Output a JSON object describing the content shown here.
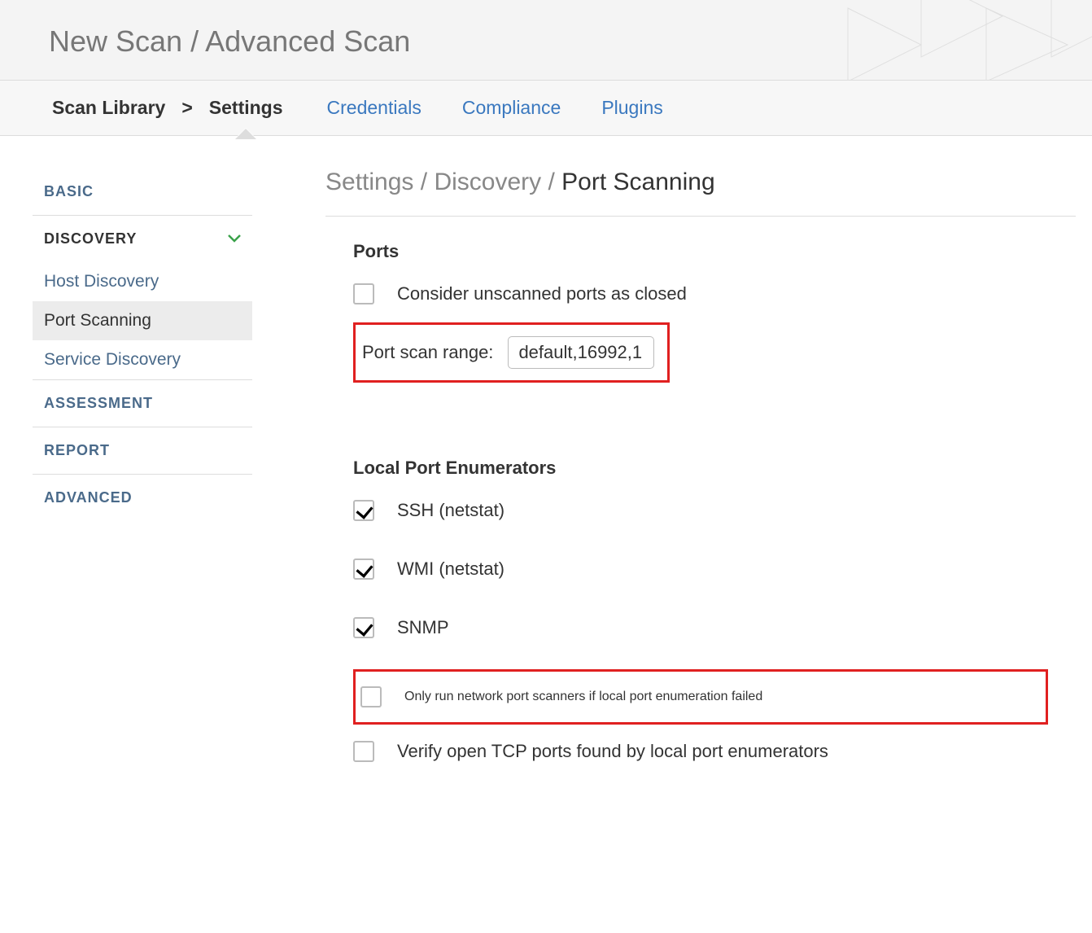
{
  "header": {
    "title": "New Scan / Advanced Scan"
  },
  "tabs": {
    "breadcrumb_root": "Scan Library",
    "breadcrumb_sep": ">",
    "breadcrumb_current": "Settings",
    "items": [
      {
        "label": "Credentials"
      },
      {
        "label": "Compliance"
      },
      {
        "label": "Plugins"
      }
    ]
  },
  "sidebar": {
    "sections": [
      {
        "label": "BASIC",
        "expanded": false
      },
      {
        "label": "DISCOVERY",
        "expanded": true,
        "children": [
          {
            "label": "Host Discovery",
            "selected": false
          },
          {
            "label": "Port Scanning",
            "selected": true
          },
          {
            "label": "Service Discovery",
            "selected": false
          }
        ]
      },
      {
        "label": "ASSESSMENT",
        "expanded": false
      },
      {
        "label": "REPORT",
        "expanded": false
      },
      {
        "label": "ADVANCED",
        "expanded": false
      }
    ]
  },
  "content": {
    "breadcrumb": {
      "a": "Settings",
      "b": "Discovery",
      "c": "Port Scanning",
      "sep": "/"
    },
    "ports": {
      "title": "Ports",
      "consider_closed_label": "Consider unscanned ports as closed",
      "consider_closed_checked": false,
      "scan_range_label": "Port scan range:",
      "scan_range_value": "default,16992,1"
    },
    "local_enum": {
      "title": "Local Port Enumerators",
      "items": [
        {
          "label": "SSH (netstat)",
          "checked": true
        },
        {
          "label": "WMI (netstat)",
          "checked": true
        },
        {
          "label": "SNMP",
          "checked": true
        }
      ],
      "only_if_failed_label": "Only run network port scanners if local port enumeration failed",
      "only_if_failed_checked": false,
      "verify_label": "Verify open TCP ports found by local port enumerators",
      "verify_checked": false
    }
  }
}
